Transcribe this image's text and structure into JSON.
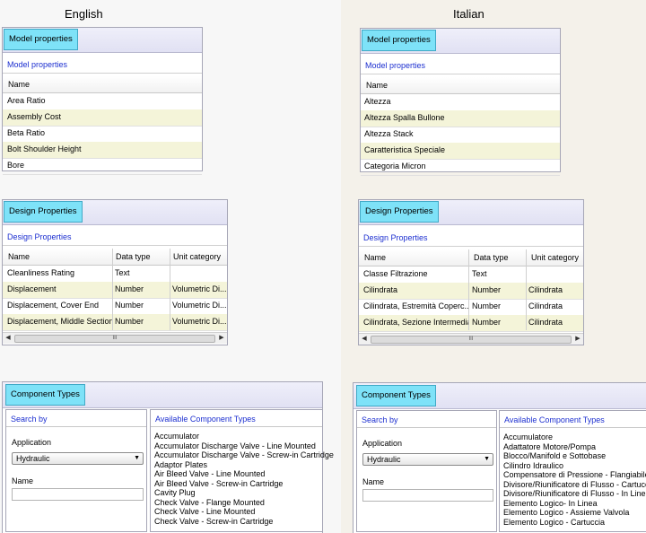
{
  "headings": {
    "english": "English",
    "italian": "Italian"
  },
  "english": {
    "model": {
      "tab": "Model properties",
      "subtitle": "Model properties",
      "column": "Name",
      "rows": [
        "Area Ratio",
        "Assembly Cost",
        "Beta Ratio",
        "Bolt Shoulder Height",
        "Bore"
      ]
    },
    "design": {
      "tab": "Design Properties",
      "subtitle": "Design Properties",
      "columns": [
        "Name",
        "Data type",
        "Unit category"
      ],
      "rows": [
        [
          "Cleanliness Rating",
          "Text",
          ""
        ],
        [
          "Displacement",
          "Number",
          "Volumetric Di..."
        ],
        [
          "Displacement, Cover End",
          "Number",
          "Volumetric Di..."
        ],
        [
          "Displacement, Middle Section",
          "Number",
          "Volumetric Di..."
        ]
      ],
      "scroll_grip": "III"
    },
    "components": {
      "tab": "Component Types",
      "search_by": "Search by",
      "available": "Available Component Types",
      "application_label": "Application",
      "application_value": "Hydraulic",
      "name_label": "Name",
      "name_value": "",
      "items": [
        "Accumulator",
        "Accumulator Discharge Valve - Line Mounted",
        "Accumulator Discharge Valve - Screw-in Cartridge",
        "Adaptor Plates",
        "Air Bleed Valve - Line Mounted",
        "Air Bleed Valve - Screw-in Cartridge",
        "Cavity Plug",
        "Check Valve - Flange Mounted",
        "Check Valve - Line Mounted",
        "Check Valve - Screw-in Cartridge"
      ]
    }
  },
  "italian": {
    "model": {
      "tab": "Model properties",
      "subtitle": "Model properties",
      "column": "Name",
      "rows": [
        "Altezza",
        "Altezza Spalla Bullone",
        "Altezza Stack",
        "Caratteristica Speciale",
        "Categoria Micron"
      ]
    },
    "design": {
      "tab": "Design Properties",
      "subtitle": "Design Properties",
      "columns": [
        "Name",
        "Data type",
        "Unit category"
      ],
      "rows": [
        [
          "Classe Filtrazione",
          "Text",
          ""
        ],
        [
          "Cilindrata",
          "Number",
          "Cilindrata"
        ],
        [
          "Cilindrata, Estremità Coperc...",
          "Number",
          "Cilindrata"
        ],
        [
          "Cilindrata, Sezione Intermedia",
          "Number",
          "Cilindrata"
        ]
      ],
      "scroll_grip": "III"
    },
    "components": {
      "tab": "Component Types",
      "search_by": "Search by",
      "available": "Available Component Types",
      "application_label": "Application",
      "application_value": "Hydraulic",
      "name_label": "Name",
      "name_value": "",
      "items": [
        "Accumulatore",
        "Adattatore Motore/Pompa",
        "Blocco/Manifold e Sottobase",
        "Cilindro Idraulico",
        "Compensatore di Pressione - Flangiabile",
        "Divisore/Riunificatore di Flusso - Cartuccia",
        "Divisore/Riunificatore di Flusso - In Linea",
        "Elemento Logico- In Linea",
        "Elemento Logico - Assieme Valvola",
        "Elemento Logico - Cartuccia"
      ]
    }
  },
  "icons": {
    "dropdown": "chevron-down-icon",
    "scroll_left": "scroll-left-icon",
    "scroll_right": "scroll-right-icon"
  }
}
